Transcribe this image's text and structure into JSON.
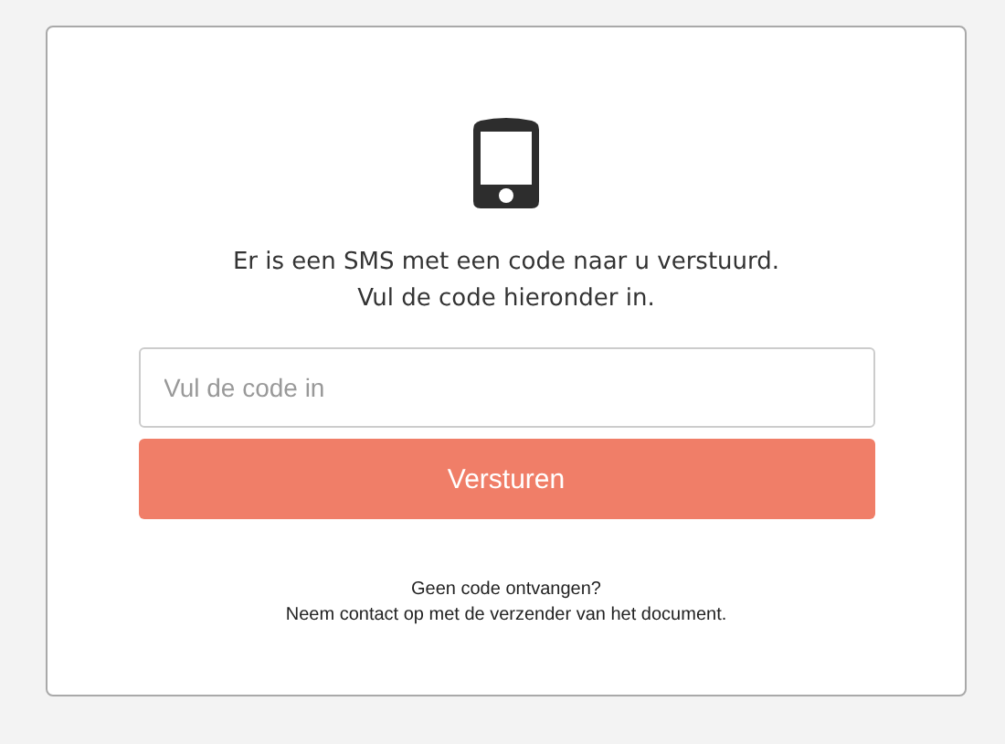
{
  "message": [
    "Er is een SMS met een code naar u verstuurd.",
    "Vul de code hieronder in."
  ],
  "code_field": {
    "placeholder": "Vul de code in"
  },
  "submit_button": {
    "label": "Versturen"
  },
  "help": [
    "Geen code ontvangen?",
    "Neem contact op met de verzender van het document."
  ]
}
